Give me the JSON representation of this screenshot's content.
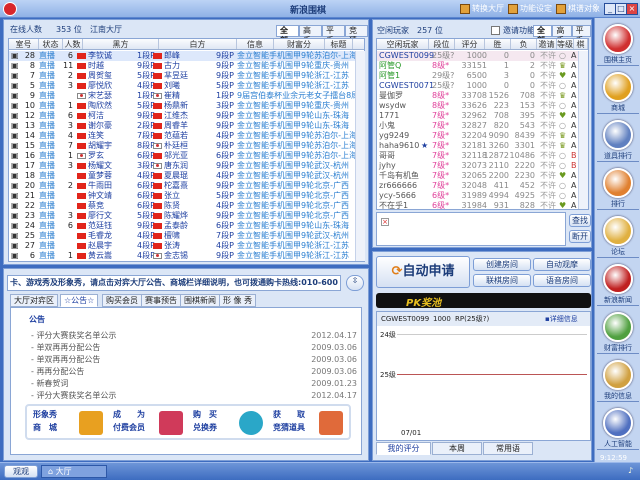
{
  "window": {
    "title": "新浪围棋",
    "toolbar": [
      "转换大厅",
      "功能设定",
      "棋谱对象"
    ],
    "controls": [
      "_",
      "□",
      "×"
    ]
  },
  "hall": {
    "online_label": "在线人数",
    "online_count": "353 位",
    "hall_name": "江南大厅",
    "filters": [
      "全部",
      "高手",
      "平手",
      "竞猜"
    ],
    "columns": [
      "室号",
      "状态",
      "人数",
      "黑方",
      "白方",
      "信息",
      "财富分",
      "标题"
    ],
    "rows": [
      [
        "28",
        "直播",
        "6",
        "李钦诚",
        "cn",
        "1段P",
        "郎峰",
        "cn",
        "9段P",
        "金立智能手机围甲9轮苏泊尔-上海"
      ],
      [
        "8",
        "直播",
        "11",
        "时越",
        "cn",
        "9段P",
        "古力",
        "cn",
        "9段P",
        "金立智能手机围甲9轮重庆-贵州"
      ],
      [
        "7",
        "直播",
        "2",
        "周贺玺",
        "cn",
        "5段P",
        "芈昱廷",
        "cn",
        "9段P",
        "金立智能手机围甲9轮浙江-江苏"
      ],
      [
        "5",
        "直播",
        "3",
        "廖悦欣",
        "cn",
        "4段P",
        "刘曦",
        "cn",
        "5段P",
        "金立智能手机围甲9轮浙江-江苏"
      ],
      [
        "9",
        "直播",
        "",
        "宋艺瑟",
        "kr",
        "1段P",
        "崔精",
        "kr",
        "1段P",
        "9届宫伯泰杯业余元老女子擂台8局"
      ],
      [
        "10",
        "直播",
        "1",
        "陶欣然",
        "cn",
        "5段P",
        "杨鼎新",
        "cn",
        "3段P",
        "金立智能手机围甲9轮重庆-贵州"
      ],
      [
        "12",
        "直播",
        "6",
        "柯洁",
        "cn",
        "9段P",
        "江维杰",
        "cn",
        "9段P",
        "金立智能手机围甲9轮山东-珠海"
      ],
      [
        "13",
        "直播",
        "3",
        "谢尔豪",
        "cn",
        "2段P",
        "周睿羊",
        "cn",
        "9段P",
        "金立智能手机围甲9轮山东-珠海"
      ],
      [
        "14",
        "直播",
        "4",
        "连笑",
        "cn",
        "7段P",
        "范蕴若",
        "cn",
        "4段P",
        "金立智能手机围甲9轮苏泊尔-上海"
      ],
      [
        "15",
        "直播",
        "7",
        "胡耀宇",
        "cn",
        "8段P",
        "朴廷桓",
        "kr",
        "9段P",
        "金立智能手机围甲9轮苏泊尔-上海"
      ],
      [
        "16",
        "直播",
        "1",
        "罗玄",
        "kr",
        "6段P",
        "邬光亚",
        "cn",
        "6段P",
        "金立智能手机围甲9轮苏泊尔-上海"
      ],
      [
        "17",
        "直播",
        "3",
        "杨耀文",
        "cn",
        "3段P",
        "唐东润",
        "kr",
        "9段P",
        "金立智能手机围甲9轮武汉-杭州"
      ],
      [
        "18",
        "直播",
        "",
        "童梦蓉",
        "cn",
        "4段P",
        "夏晨琨",
        "cn",
        "4段P",
        "金立智能手机围甲9轮武汉-杭州"
      ],
      [
        "20",
        "直播",
        "2",
        "牛雨田",
        "cn",
        "6段P",
        "柁嘉熹",
        "cn",
        "9段P",
        "金立智能手机围甲9轮北京-广西"
      ],
      [
        "21",
        "直播",
        "",
        "钟文靖",
        "cn",
        "6段P",
        "张立",
        "cn",
        "5段P",
        "金立智能手机围甲9轮北京-广西"
      ],
      [
        "22",
        "直播",
        "",
        "蔡竞",
        "cn",
        "6段P",
        "陈贤",
        "cn",
        "4段P",
        "金立智能手机围甲9轮北京-广西"
      ],
      [
        "23",
        "直播",
        "3",
        "廖行文",
        "cn",
        "5段P",
        "陈耀烨",
        "cn",
        "9段P",
        "金立智能手机围甲9轮北京-广西"
      ],
      [
        "24",
        "直播",
        "6",
        "范廷钰",
        "cn",
        "9段P",
        "孟泰龄",
        "cn",
        "6段P",
        "金立智能手机围甲9轮山东-珠海"
      ],
      [
        "25",
        "直播",
        "",
        "毛睿龙",
        "cn",
        "4段P",
        "檀啸",
        "cn",
        "7段P",
        "金立智能手机围甲9轮武汉-杭州"
      ],
      [
        "27",
        "直播",
        "",
        "赵晨宇",
        "cn",
        "4段P",
        "张涛",
        "cn",
        "4段P",
        "金立智能手机围甲9轮浙江-江苏"
      ],
      [
        "6",
        "直播",
        "1",
        "黄云嵩",
        "cn",
        "4段P",
        "金志锡",
        "kr",
        "9段P",
        "金立智能手机围甲9轮浙江-江苏"
      ]
    ]
  },
  "idle": {
    "label": "空闲玩家",
    "count": "257 位",
    "invite_label": "邀请功能",
    "filters": [
      "全部",
      "高手",
      "平手"
    ],
    "columns": [
      "空闲玩家",
      "段位",
      "评分",
      "胜",
      "负",
      "邀请",
      "等级",
      "棋品"
    ],
    "rows": [
      [
        "CGWEST0099",
        "",
        "25级?",
        "1000",
        "0",
        "0",
        "不许",
        "egg",
        "A"
      ],
      [
        "阿管Q",
        "",
        "8级*",
        "33151",
        "1",
        "2",
        "不许",
        "crown",
        "A"
      ],
      [
        "阿管1",
        "",
        "29级?",
        "6500",
        "3",
        "0",
        "不许",
        "heart",
        "A"
      ],
      [
        "CGWEST0071",
        "",
        "25级?",
        "1000",
        "0",
        "0",
        "不许",
        "egg",
        "A"
      ],
      [
        "曼伽罗",
        "",
        "8级*",
        "33708",
        "1526",
        "708",
        "不许",
        "crown",
        "A"
      ],
      [
        "wsydw",
        "",
        "8级*",
        "33626",
        "223",
        "153",
        "不许",
        "egg",
        "A"
      ],
      [
        "1771",
        "",
        "7级*",
        "32962",
        "708",
        "395",
        "不许",
        "heart",
        "A"
      ],
      [
        "小鬼",
        "",
        "7级*",
        "32827",
        "820",
        "543",
        "不许",
        "egg",
        "A"
      ],
      [
        "yg9249",
        "",
        "7级*",
        "32204",
        "9090",
        "8439",
        "不许",
        "crown",
        "A"
      ],
      [
        "haha9610",
        "★",
        "7级*",
        "32181",
        "3260",
        "3301",
        "不许",
        "crown",
        "A"
      ],
      [
        "哥哥",
        "",
        "7级*",
        "32118",
        "12872",
        "10486",
        "不许",
        "egg",
        "B"
      ],
      [
        "jyhy",
        "",
        "7级*",
        "32073",
        "2110",
        "2220",
        "不许",
        "egg",
        "B"
      ],
      [
        "千岛有机鱼",
        "",
        "7级*",
        "32065",
        "2200",
        "2230",
        "不许",
        "heart",
        "A"
      ],
      [
        "zr666666",
        "",
        "7级*",
        "32048",
        "411",
        "452",
        "不许",
        "egg",
        "A"
      ],
      [
        "ycy-5666",
        "",
        "6级*",
        "31989",
        "4994",
        "4925",
        "不许",
        "egg",
        "A"
      ],
      [
        "不在乎1",
        "",
        "6级*",
        "31984",
        "931",
        "828",
        "不许",
        "heart",
        "A"
      ]
    ],
    "search_label": "查找",
    "disconnect_label": "断开"
  },
  "notice": {
    "marquee": "卡、游戏秀及形象秀，请点击对弈大厅公告、商城栏详细说明，也可拨通购卡热线:010-600",
    "tabs": [
      "大厅对弈区",
      "☆公告☆",
      "购买会员",
      "赛事预告",
      "围棋新闻",
      "形 像 秀"
    ],
    "heading": "公告",
    "items": [
      [
        "评分大赛获奖名单公示",
        "2012.04.17"
      ],
      [
        "单双再再分配公告",
        "2009.03.06"
      ],
      [
        "单双再再分配公告",
        "2009.03.06"
      ],
      [
        "再再分配公告",
        "2009.03.06"
      ],
      [
        "新春贺词",
        "2009.01.23"
      ],
      [
        "评分大赛获奖名单公示",
        "2012.04.17"
      ]
    ],
    "promos": [
      [
        "形象秀",
        "商　城"
      ],
      [
        "成　　为",
        "付费会员"
      ],
      [
        "购　买",
        "兑换券"
      ],
      [
        "获　　取",
        "竞猜道具"
      ]
    ]
  },
  "actions": {
    "auto_apply": "自动申请",
    "buttons": [
      "创建房间",
      "自动观摩",
      "联棋房间",
      "语音房间"
    ],
    "pk_label": "PK奖池"
  },
  "rating": {
    "user": "CGWEST0099",
    "score": "1000",
    "rank": "RP(25级?)",
    "detail": "详细信息",
    "y_labels": [
      "24级",
      "25级"
    ],
    "x_label": "07/01",
    "tabs": [
      "我的评分",
      "本周",
      "常用语"
    ]
  },
  "sidebar": [
    "围棋主页",
    "商城",
    "道具排行",
    "排行",
    "论坛",
    "新浪新闻",
    "财富排行",
    "我的信息",
    "人工智能"
  ],
  "taskbar": {
    "items": [
      "观观",
      "大厅"
    ],
    "clock": "9:12:59"
  },
  "colors": {
    "frame": "#3d6cc0",
    "panel": "#dbe6f6",
    "link": "#2a7ed0",
    "rank": "#e0409a"
  }
}
